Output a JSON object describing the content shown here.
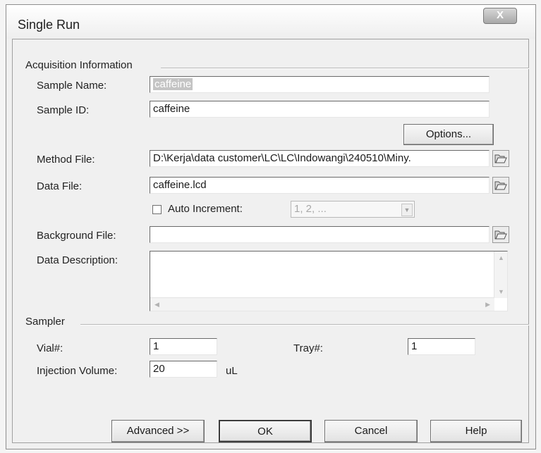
{
  "window": {
    "title": "Single Run",
    "close_label": "X"
  },
  "acquisition": {
    "group_label": "Acquisition Information",
    "sample_name_label": "Sample Name:",
    "sample_name_value": "caffeine",
    "sample_id_label": "Sample ID:",
    "sample_id_value": "caffeine",
    "options_label": "Options...",
    "method_file_label": "Method File:",
    "method_file_value": "D:\\Kerja\\data customer\\LC\\LC\\Indowangi\\240510\\Miny.",
    "data_file_label": "Data File:",
    "data_file_value": "caffeine.lcd",
    "auto_increment_label": "Auto Increment:",
    "auto_increment_checked": false,
    "auto_increment_option": "1, 2, ...",
    "background_file_label": "Background File:",
    "background_file_value": "",
    "data_description_label": "Data Description:",
    "data_description_value": ""
  },
  "sampler": {
    "group_label": "Sampler",
    "vial_label": "Vial#:",
    "vial_value": "1",
    "tray_label": "Tray#:",
    "tray_value": "1",
    "injection_volume_label": "Injection Volume:",
    "injection_volume_value": "20",
    "injection_volume_unit": "uL"
  },
  "buttons": {
    "advanced": "Advanced >>",
    "ok": "OK",
    "cancel": "Cancel",
    "help": "Help"
  },
  "icons": {
    "close": "close-icon",
    "folder": "folder-open-icon",
    "dropdown": "chevron-down-icon"
  }
}
